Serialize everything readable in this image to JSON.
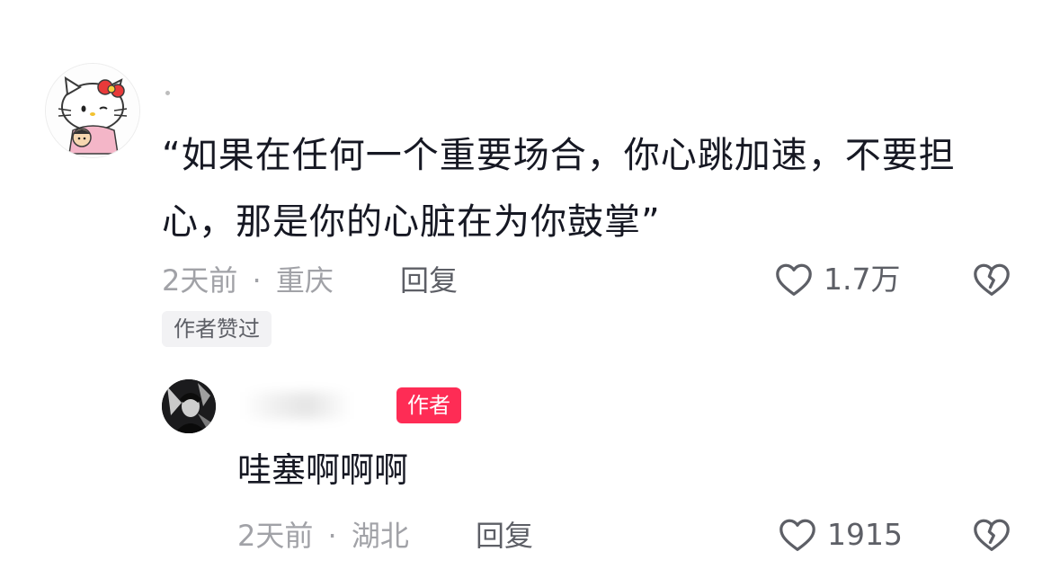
{
  "comment": {
    "text": "“如果在任何一个重要场合，你心跳加速，不要担心，那是你的心脏在为你鼓掌”",
    "time": "2天前",
    "separator": "·",
    "location": "重庆",
    "reply_label": "回复",
    "like_count": "1.7万",
    "author_liked_tag": "作者赞过"
  },
  "reply": {
    "author_tag": "作者",
    "text": "哇塞啊啊啊",
    "time": "2天前",
    "separator": "·",
    "location": "湖北",
    "reply_label": "回复",
    "like_count": "1915"
  },
  "icons": {
    "avatar_main": "hello-kitty-avatar",
    "avatar_reply": "dark-portrait-avatar",
    "like": "heart-outline-icon",
    "dislike": "broken-heart-icon"
  },
  "colors": {
    "author_tag_bg": "#fe2c55",
    "text_primary": "#161823",
    "text_secondary": "#a1a2a7"
  }
}
